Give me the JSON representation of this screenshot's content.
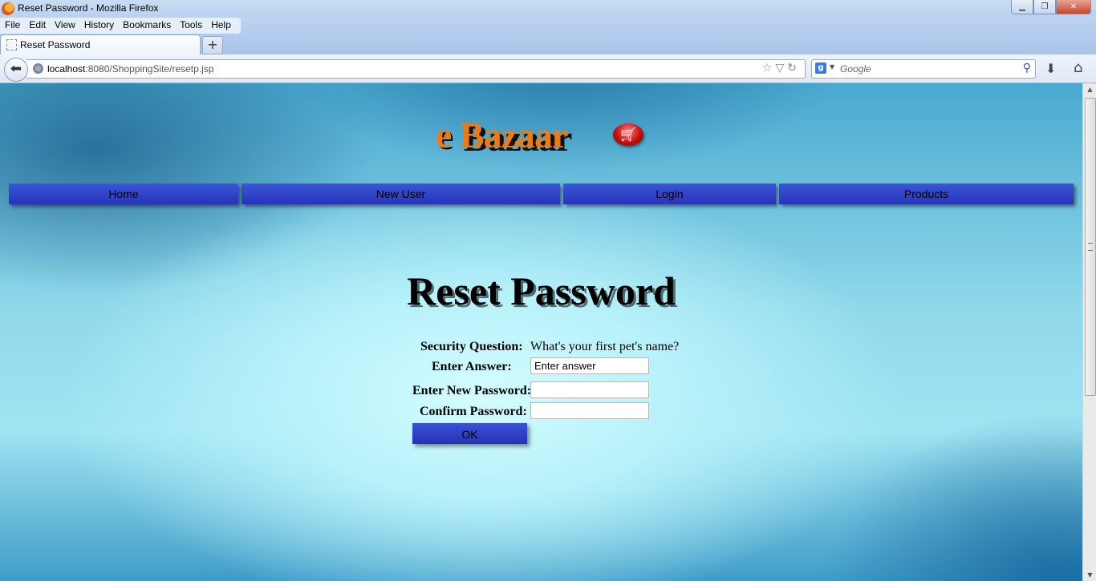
{
  "browser": {
    "window_title": "Reset Password - Mozilla Firefox",
    "menu": [
      "File",
      "Edit",
      "View",
      "History",
      "Bookmarks",
      "Tools",
      "Help"
    ],
    "tab_title": "Reset Password",
    "new_tab_label": "+",
    "url_host": "localhost",
    "url_rest": ":8080/ShoppingSite/resetp.jsp",
    "search_placeholder": "Google",
    "search_engine_icon": "g-icon"
  },
  "site": {
    "logo_e": "e",
    "logo_bazaar": "Bazaar",
    "nav": {
      "home": "Home",
      "new_user": "New User",
      "login": "Login",
      "products": "Products"
    },
    "colors": {
      "logo": "#f07a10",
      "nav_bg": "#2f42c8"
    }
  },
  "form": {
    "title": "Reset Password",
    "security_question_label": "Security Question:",
    "security_question": "What's your first pet's name?",
    "answer_label": "Enter Answer:",
    "answer_placeholder": "Enter answer",
    "answer_value": "",
    "new_password_label": "Enter New Password:",
    "new_password_value": "",
    "confirm_password_label": "Confirm Password:",
    "confirm_password_value": "",
    "ok_label": "OK"
  }
}
